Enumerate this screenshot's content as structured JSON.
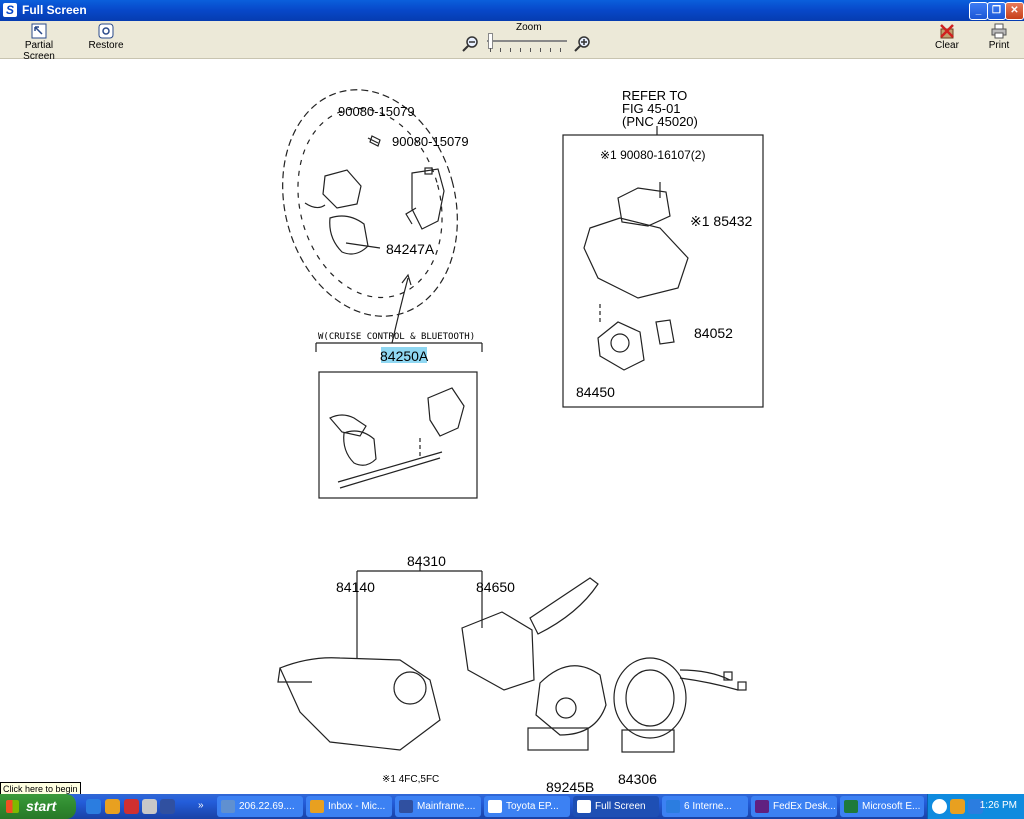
{
  "window": {
    "title": "Full Screen"
  },
  "toolbar": {
    "partial_screen": "Partial Screen",
    "restore": "Restore",
    "zoom": "Zoom",
    "clear": "Clear",
    "print": "Print"
  },
  "diagram": {
    "steering_wheel": {
      "bolt1": "90080-15079",
      "bolt2": "90080-15079",
      "switch": "84247A"
    },
    "variant_label": "W(CRUISE CONTROL & BLUETOOTH)",
    "assembly": "84250A",
    "refer": {
      "line1": "REFER TO",
      "line2": "FIG   45-01",
      "line3": "(PNC 45020)"
    },
    "lock_box": {
      "screw": "※1  90080-16107(2)",
      "part1": "※1 85432",
      "part2": "84052",
      "part3": "84450"
    },
    "combo": {
      "main": "84310",
      "left": "84140",
      "right": "84650"
    },
    "spiral": {
      "part1": "89245B",
      "part2": "84306"
    },
    "footnote": "※1  4FC,5FC"
  },
  "tooltip": "Click here to begin",
  "taskbar": {
    "start": "start",
    "tasks": [
      {
        "label": "206.22.69...."
      },
      {
        "label": "Inbox - Mic..."
      },
      {
        "label": "Mainframe...."
      },
      {
        "label": "Toyota EP..."
      },
      {
        "label": "Full Screen"
      },
      {
        "label": "6 Interne..."
      },
      {
        "label": "FedEx Desk..."
      },
      {
        "label": "Microsoft E..."
      }
    ],
    "clock": "1:26 PM"
  },
  "colors": {
    "titlebar": "#0747c8",
    "taskbar": "#245edb",
    "start": "#2f8a2f",
    "highlight": "#33b6e8"
  }
}
